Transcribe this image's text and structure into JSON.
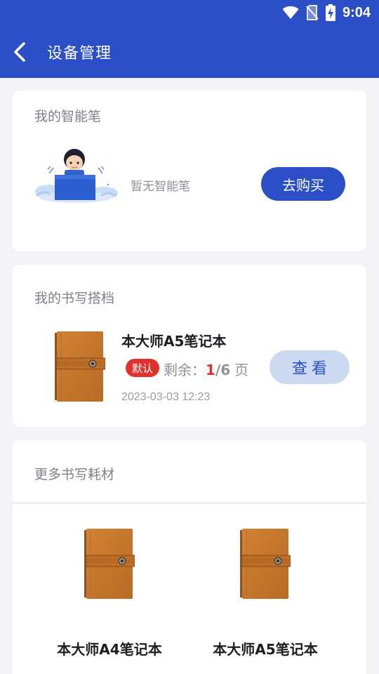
{
  "status_bar": {
    "time": "9:04"
  },
  "nav": {
    "title": "设备管理"
  },
  "pen_card": {
    "title": "我的智能笔",
    "empty_text": "暂无智能笔",
    "buy_label": "去购买"
  },
  "partner_card": {
    "title": "我的书写搭档",
    "notebook": {
      "name": "本大师A5笔记本",
      "badge": "默认",
      "remain_label": "剩余：",
      "remain_current": "1",
      "remain_total": "/6",
      "remain_unit": "页",
      "date": "2023-03-03 12:23"
    },
    "view_label": "查看"
  },
  "more_card": {
    "title": "更多书写耗材",
    "products": [
      {
        "name": "本大师A4笔记本"
      },
      {
        "name": "本大师A5笔记本"
      }
    ]
  },
  "colors": {
    "primary": "#2c4fc8",
    "badge_red": "#e0322c",
    "view_button_bg": "#cdd8f1",
    "notebook_brown": "#c8772a"
  }
}
